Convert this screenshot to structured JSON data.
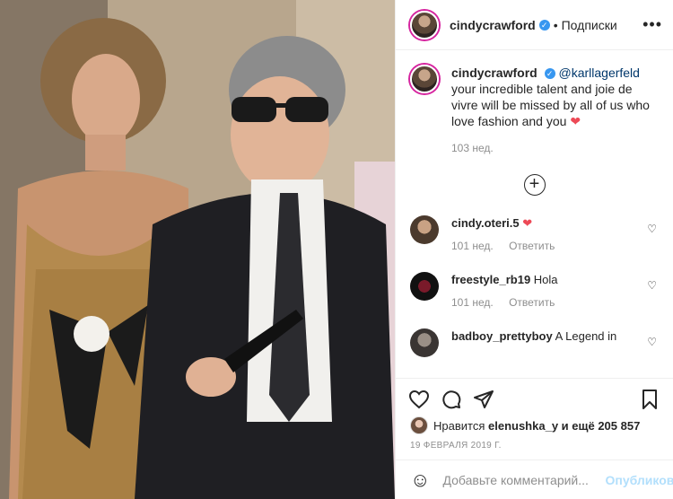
{
  "header": {
    "username": "cindycrawford",
    "verified_mark": "✓",
    "separator": "•",
    "follow_label": "Подписки",
    "more_label": "•••"
  },
  "caption": {
    "username": "cindycrawford",
    "mention": "@karllagerfeld",
    "text": "your incredible talent and joie de vivre will be missed by all of us who love fashion and you",
    "heart": "❤",
    "time": "103 нед."
  },
  "load_more_label": "+",
  "comments": [
    {
      "username": "cindy.oteri.5",
      "text": "❤",
      "time": "101 нед.",
      "reply": "Ответить"
    },
    {
      "username": "freestyle_rb19",
      "text": "Hola",
      "time": "101 нед.",
      "reply": "Ответить"
    },
    {
      "username": "badboy_prettyboy",
      "text": "A Legend in",
      "time": "",
      "reply": ""
    }
  ],
  "likes": {
    "prefix": "Нравится",
    "user": "elenushka_y",
    "suffix": "и ещё 205 857"
  },
  "date": "19 ФЕВРАЛЯ 2019 Г.",
  "add_comment": {
    "placeholder": "Добавьте комментарий...",
    "post_label": "Опубликовать"
  },
  "colors": {
    "accent": "#3897f0",
    "like_red": "#ed4956",
    "post_disabled": "#b2dffc"
  }
}
